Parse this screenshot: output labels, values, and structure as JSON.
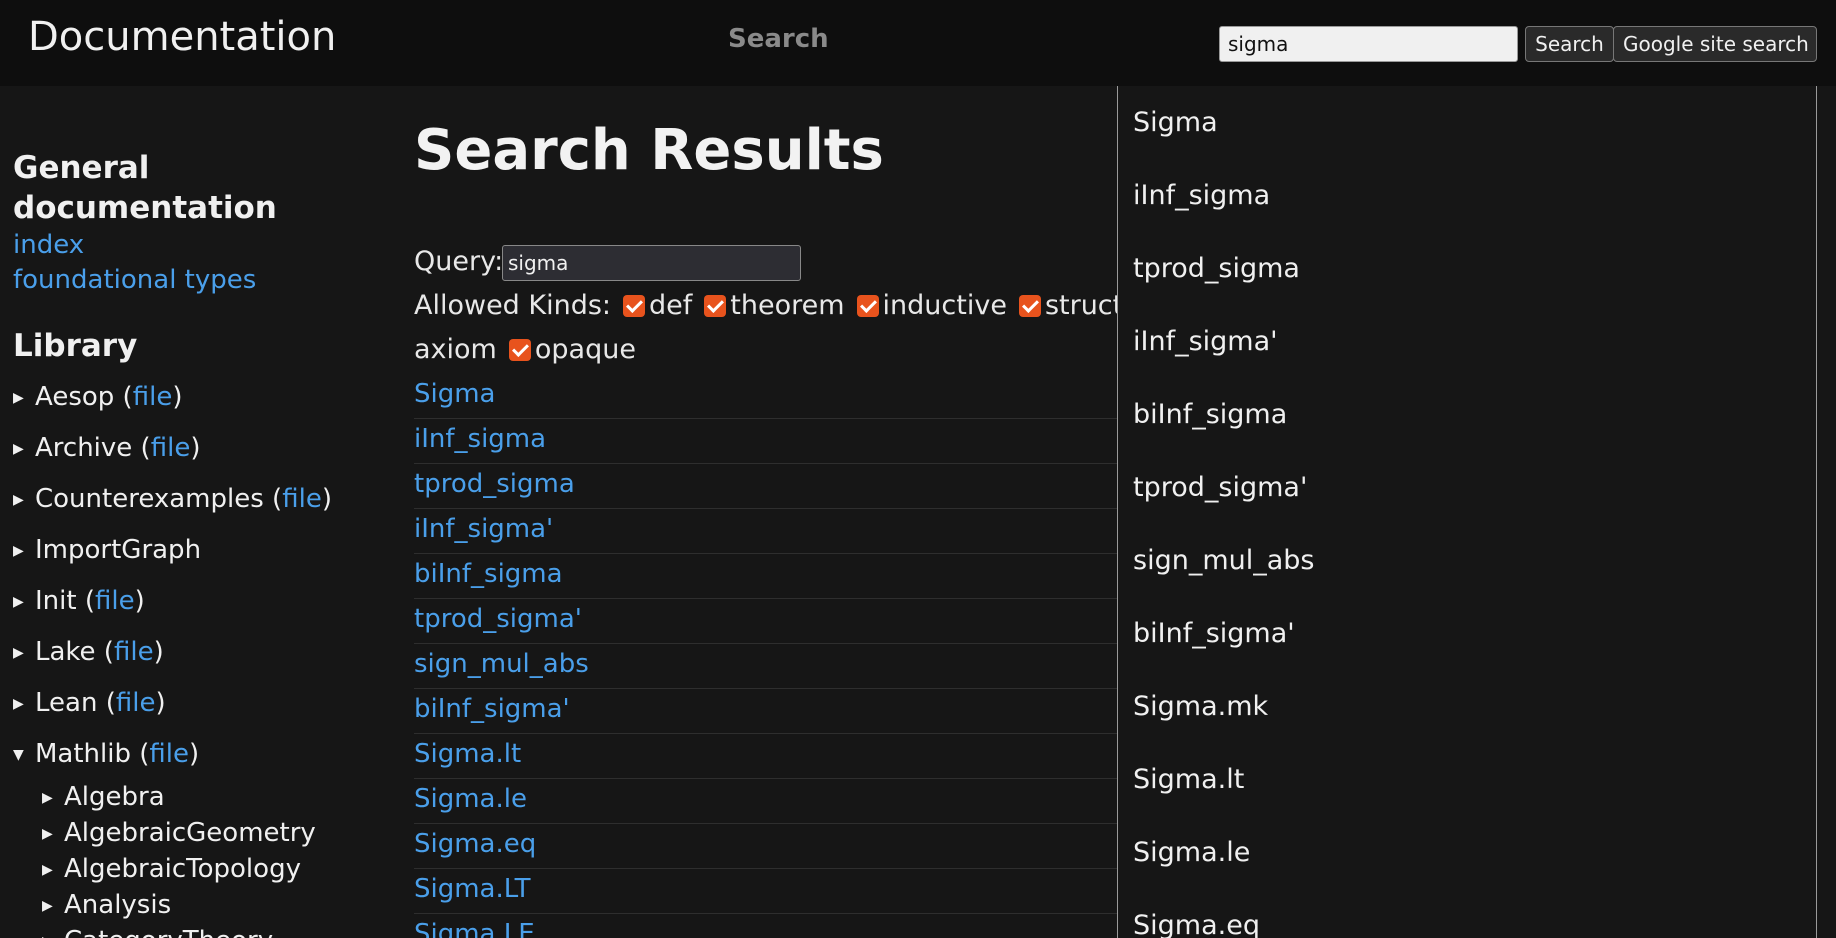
{
  "header": {
    "brand": "Documentation",
    "search_label": "Search",
    "search_value": "sigma",
    "search_button": "Search",
    "google_button": "Google site search"
  },
  "sidebar": {
    "general_heading": "General documentation",
    "general_links": [
      "index",
      "foundational types"
    ],
    "library_heading": "Library",
    "file_label": "file",
    "items": [
      {
        "name": "Aesop",
        "has_file": true
      },
      {
        "name": "Archive",
        "has_file": true
      },
      {
        "name": "Counterexamples",
        "has_file": true
      },
      {
        "name": "ImportGraph",
        "has_file": false
      },
      {
        "name": "Init",
        "has_file": true
      },
      {
        "name": "Lake",
        "has_file": true
      },
      {
        "name": "Lean",
        "has_file": true
      }
    ],
    "expanded_item": {
      "name": "Mathlib",
      "has_file": true
    },
    "sub_items": [
      "Algebra",
      "AlgebraicGeometry",
      "AlgebraicTopology",
      "Analysis",
      "CategoryTheory"
    ]
  },
  "main": {
    "title": "Search Results",
    "query_label": "Query:",
    "query_value": "sigma",
    "kinds_label": "Allowed Kinds:",
    "kinds_line1": [
      "def",
      "theorem",
      "inductive",
      "structure"
    ],
    "kinds_line2_leading": "axiom",
    "kinds_line2": [
      "opaque"
    ],
    "results": [
      "Sigma",
      "iInf_sigma",
      "tprod_sigma",
      "iInf_sigma'",
      "biInf_sigma",
      "tprod_sigma'",
      "sign_mul_abs",
      "biInf_sigma'",
      "Sigma.lt",
      "Sigma.le",
      "Sigma.eq",
      "Sigma.LT",
      "Sigma.LE"
    ]
  },
  "dropdown": {
    "items": [
      "Sigma",
      "iInf_sigma",
      "tprod_sigma",
      "iInf_sigma'",
      "biInf_sigma",
      "tprod_sigma'",
      "sign_mul_abs",
      "biInf_sigma'",
      "Sigma.mk",
      "Sigma.lt",
      "Sigma.le",
      "Sigma.eq"
    ]
  },
  "colors": {
    "link": "#4a9fea",
    "checkbox": "#e8531d",
    "background": "#161616",
    "header": "#0e0e0e"
  }
}
